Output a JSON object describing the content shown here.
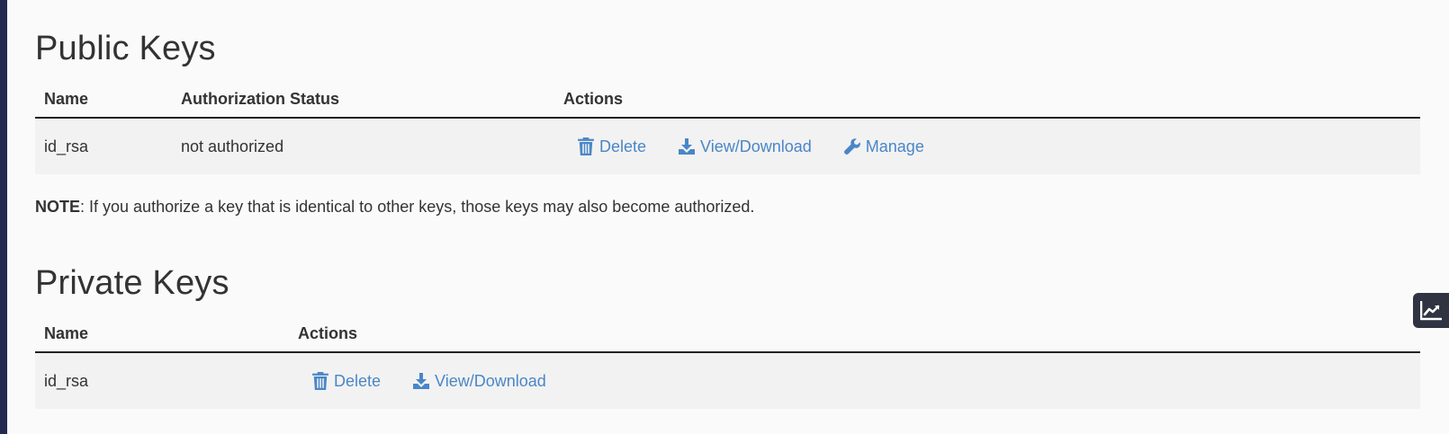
{
  "public_keys": {
    "title": "Public Keys",
    "columns": [
      "Name",
      "Authorization Status",
      "Actions"
    ],
    "rows": [
      {
        "name": "id_rsa",
        "status": "not authorized",
        "actions": {
          "delete": "Delete",
          "view_download": "View/Download",
          "manage": "Manage"
        }
      }
    ]
  },
  "note": {
    "label": "NOTE",
    "text": ": If you authorize a key that is identical to other keys, those keys may also become authorized."
  },
  "private_keys": {
    "title": "Private Keys",
    "columns": [
      "Name",
      "Actions"
    ],
    "rows": [
      {
        "name": "id_rsa",
        "actions": {
          "delete": "Delete",
          "view_download": "View/Download"
        }
      }
    ]
  },
  "colors": {
    "link": "#4a86c7",
    "text": "#333333",
    "background": "#fafafa",
    "row_background": "#f2f2f2",
    "left_strip": "#222a52",
    "stats_button": "#2f3342"
  },
  "icons": {
    "delete": "trash-icon",
    "view_download": "download-icon",
    "manage": "wrench-icon",
    "stats": "chart-line-icon"
  }
}
